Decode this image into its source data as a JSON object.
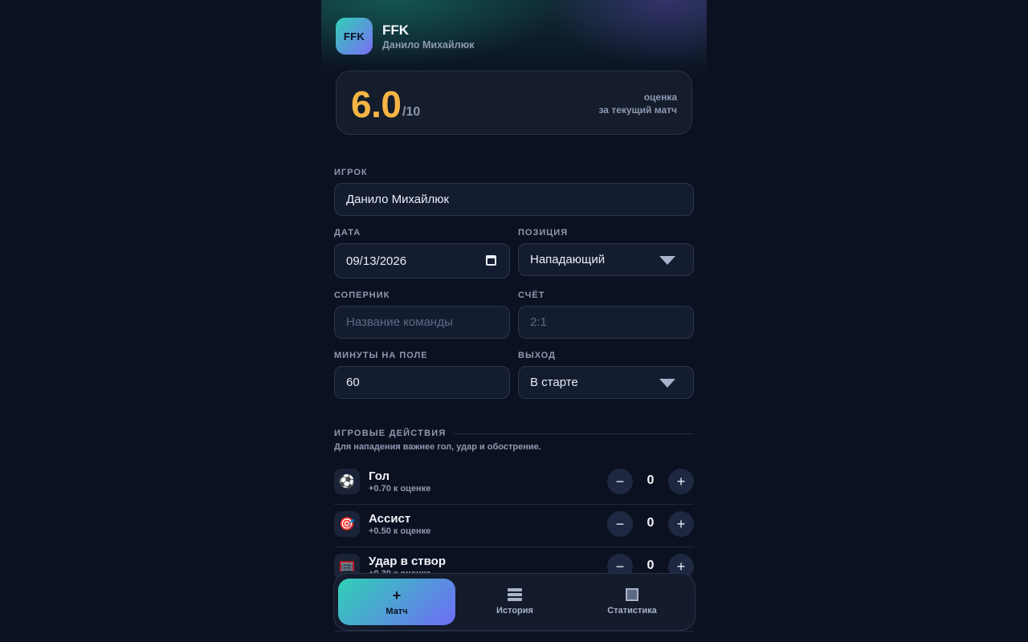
{
  "header": {
    "logo_text": "FFK",
    "title": "FFK",
    "subtitle": "Данило Михайлюк"
  },
  "score": {
    "value": "6.0",
    "max": "/10",
    "caption_line1": "оценка",
    "caption_line2": "за текущий матч",
    "value_color": "#f5b544"
  },
  "form": {
    "player_label": "ИГРОК",
    "player_value": "Данило Михайлюк",
    "date_label": "ДАТА",
    "date_value": "09/13/2026",
    "position_label": "ПОЗИЦИЯ",
    "position_value": "Нападающий",
    "opponent_label": "СОПЕРНИК",
    "opponent_placeholder": "Название команды",
    "score_label": "СЧЁТ",
    "score_placeholder": "2:1",
    "minutes_label": "МИНУТЫ НА ПОЛЕ",
    "minutes_value": "60",
    "entry_label": "ВЫХОД",
    "entry_value": "В старте"
  },
  "actions": {
    "title": "ИГРОВЫЕ ДЕЙСТВИЯ",
    "hint": "Для нападения важнее гол, удар и обострение.",
    "items": [
      {
        "icon": "⚽",
        "icon_name": "soccer-ball-icon",
        "name": "Гол",
        "bonus": "+0.70 к оценке",
        "count": "0"
      },
      {
        "icon": "🎯",
        "icon_name": "target-icon",
        "name": "Ассист",
        "bonus": "+0.50 к оценке",
        "count": "0"
      },
      {
        "icon": "🥅",
        "icon_name": "goal-net-icon",
        "name": "Удар в створ",
        "bonus": "+0.30 к оценке",
        "count": "0"
      }
    ],
    "minus": "−",
    "plus": "+"
  },
  "nav": {
    "match_icon": "+",
    "match_label": "Матч",
    "history_label": "История",
    "stats_label": "Статистика",
    "accent_from": "#2fd1b5",
    "accent_to": "#6f6cf6"
  }
}
